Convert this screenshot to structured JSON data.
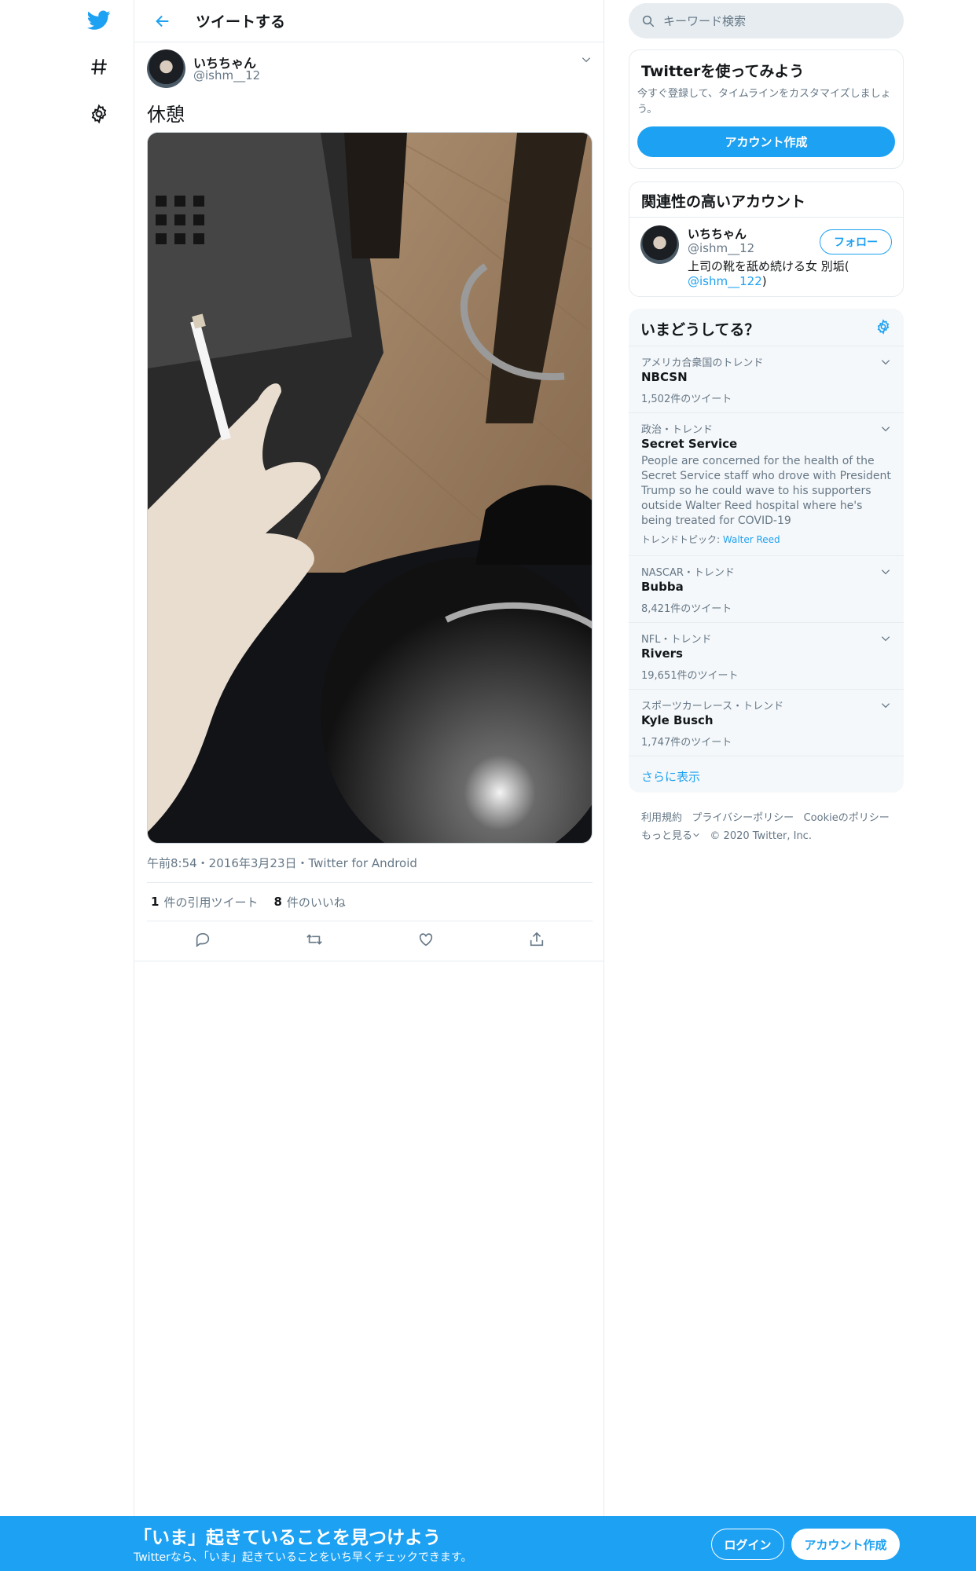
{
  "nav": {
    "icons": [
      "twitter-bird-icon",
      "hashtag-icon",
      "gear-icon"
    ]
  },
  "header": {
    "title": "ツイートする"
  },
  "tweet": {
    "display_name": "いちちゃん",
    "handle": "@ishm__12",
    "text": "休憩",
    "meta": "午前8:54・2016年3月23日・Twitter for Android",
    "quote_count": "1",
    "quote_label": "件の引用ツイート",
    "like_count": "8",
    "like_label": "件のいいね"
  },
  "search": {
    "placeholder": "キーワード検索"
  },
  "signup_card": {
    "title": "Twitterを使ってみよう",
    "desc": "今すぐ登録して、タイムラインをカスタマイズしましょう。",
    "button": "アカウント作成"
  },
  "related": {
    "title": "関連性の高いアカウント",
    "name": "いちちゃん",
    "handle": "@ishm__12",
    "follow": "フォロー",
    "bio": "上司の靴を舐め続ける女 別垢(",
    "bio_link": "@ishm__122",
    "bio_end": ")"
  },
  "trends": {
    "title": "いまどうしてる？",
    "items": [
      {
        "meta": "アメリカ合衆国のトレンド",
        "name": "NBCSN",
        "count": "1,502件のツイート"
      },
      {
        "meta": "政治・トレンド",
        "name": "Secret Service",
        "desc": "People are concerned for the health of the Secret Service staff who drove with President Trump so he could wave to his supporters outside Walter Reed hospital where he's being treated for COVID-19",
        "topic_label": "トレンドトピック:",
        "topic": "Walter Reed"
      },
      {
        "meta": "NASCAR・トレンド",
        "name": "Bubba",
        "count": "8,421件のツイート"
      },
      {
        "meta": "NFL・トレンド",
        "name": "Rivers",
        "count": "19,651件のツイート"
      },
      {
        "meta": "スポーツカーレース・トレンド",
        "name": "Kyle Busch",
        "count": "1,747件のツイート"
      }
    ],
    "show_more": "さらに表示"
  },
  "footer": {
    "terms": "利用規約",
    "privacy": "プライバシーポリシー",
    "cookie": "Cookieのポリシー",
    "more": "もっと見る",
    "copyright": "© 2020 Twitter, Inc."
  },
  "bottombar": {
    "title": "「いま」起きていることを見つけよう",
    "subtitle": "Twitterなら、「いま」起きていることをいち早くチェックできます。",
    "login": "ログイン",
    "signup": "アカウント作成"
  },
  "colors": {
    "accent": "#1da1f2",
    "text": "#14171a",
    "muted": "#657786",
    "border": "#e6ecf0"
  }
}
